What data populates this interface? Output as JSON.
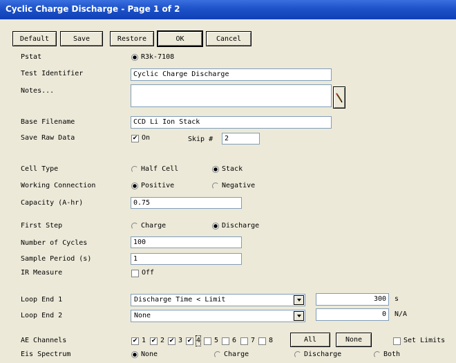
{
  "window": {
    "title": "Cyclic Charge Discharge - Page 1 of 2"
  },
  "buttons": {
    "default": "Default",
    "save": "Save",
    "restore": "Restore",
    "ok": "OK",
    "cancel": "Cancel"
  },
  "pstat": {
    "label": "Pstat",
    "value": "R3k-7108"
  },
  "test_identifier": {
    "label": "Test Identifier",
    "value": "Cyclic Charge Discharge"
  },
  "notes": {
    "label": "Notes...",
    "value": ""
  },
  "base_filename": {
    "label": "Base Filename",
    "value": "CCD Li Ion Stack"
  },
  "save_raw_data": {
    "label": "Save Raw Data",
    "checkbox_label": "On",
    "checked": true,
    "skip_label": "Skip #",
    "skip_value": "2"
  },
  "cell_type": {
    "label": "Cell Type",
    "options": [
      "Half Cell",
      "Stack"
    ],
    "selected": "Stack"
  },
  "working_connection": {
    "label": "Working Connection",
    "options": [
      "Positive",
      "Negative"
    ],
    "selected": "Positive"
  },
  "capacity": {
    "label": "Capacity (A-hr)",
    "value": "0.75"
  },
  "first_step": {
    "label": "First Step",
    "options": [
      "Charge",
      "Discharge"
    ],
    "selected": "Discharge"
  },
  "number_of_cycles": {
    "label": "Number of Cycles",
    "value": "100"
  },
  "sample_period": {
    "label": "Sample Period (s)",
    "value": "1"
  },
  "ir_measure": {
    "label": "IR Measure",
    "checkbox_label": "Off",
    "checked": false
  },
  "loop_end_1": {
    "label": "Loop End 1",
    "selection": "Discharge Time < Limit",
    "value": "300",
    "unit": "s"
  },
  "loop_end_2": {
    "label": "Loop End 2",
    "selection": "None",
    "value": "0",
    "unit": "N/A"
  },
  "ae_channels": {
    "label": "AE Channels",
    "channels": [
      {
        "label": "1",
        "checked": true
      },
      {
        "label": "2",
        "checked": true
      },
      {
        "label": "3",
        "checked": true
      },
      {
        "label": "4",
        "checked": true
      },
      {
        "label": "5",
        "checked": false
      },
      {
        "label": "6",
        "checked": false
      },
      {
        "label": "7",
        "checked": false
      },
      {
        "label": "8",
        "checked": false
      }
    ],
    "all_button": "All",
    "none_button": "None",
    "set_limits": "Set Limits"
  },
  "eis_spectrum": {
    "label": "Eis Spectrum",
    "options": [
      "None",
      "Charge",
      "Discharge",
      "Both"
    ],
    "selected": "None"
  }
}
